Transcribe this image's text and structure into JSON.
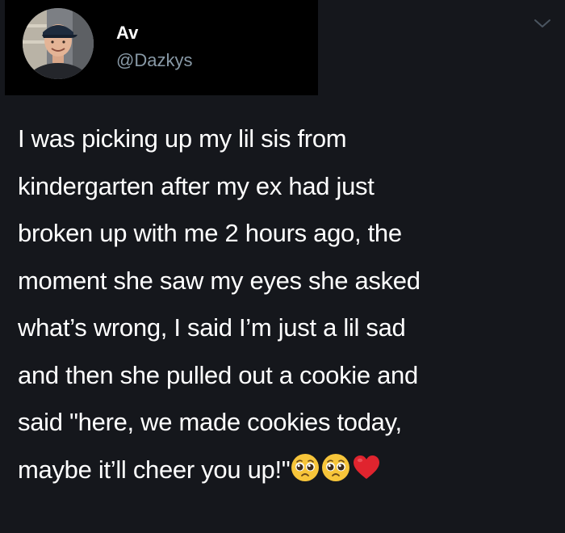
{
  "author": {
    "display_name": "Av",
    "username": "@Dazkys"
  },
  "tweet": {
    "lines": [
      "I was picking up my lil sis from",
      "kindergarten after my ex had just",
      "broken up with me 2 hours ago, the",
      "moment she saw my eyes she asked",
      "what’s wrong, I said I’m just a lil sad",
      "and then she pulled out a cookie and",
      "said \"here, we made cookies today,",
      "maybe it’ll cheer you up!\""
    ],
    "emojis": [
      "pleading-face-emoji",
      "pleading-face-emoji",
      "red-heart-emoji"
    ]
  },
  "icons": {
    "menu": "chevron-down-icon"
  },
  "colors": {
    "background": "#15171c",
    "header_panel": "#000000",
    "text": "#ffffff",
    "username": "#8899a6",
    "chevron": "#4a5560",
    "emoji_face": "#f7c53a",
    "heart": "#e0242e"
  }
}
